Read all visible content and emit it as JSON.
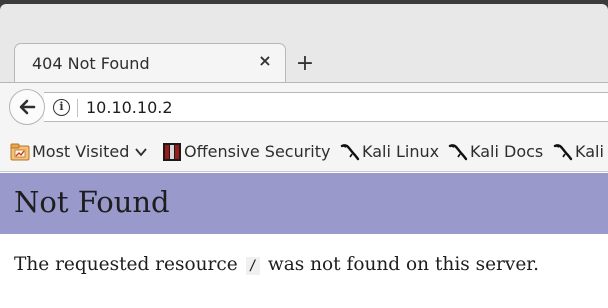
{
  "tab": {
    "title": "404 Not Found",
    "close_glyph": "×",
    "new_tab_glyph": "+"
  },
  "navbar": {
    "back_icon": "back-arrow-icon",
    "info_icon": "info-icon",
    "url": "10.10.10.2"
  },
  "bookmarks": [
    {
      "label": "Most Visited",
      "icon": "most-visited-folder-icon"
    },
    {
      "label": "Offensive Security",
      "icon": "offensive-security-icon"
    },
    {
      "label": "Kali Linux",
      "icon": "kali-dragon-icon"
    },
    {
      "label": "Kali Docs",
      "icon": "kali-dragon-icon"
    },
    {
      "label": "Kali",
      "icon": "kali-dragon-icon"
    }
  ],
  "page": {
    "heading": "Not Found",
    "message_before": "The requested resource",
    "resource": "/",
    "message_after": "was not found on this server."
  },
  "colors": {
    "header_bg": "#9999cc",
    "chrome_bg": "#f5f5f5"
  }
}
